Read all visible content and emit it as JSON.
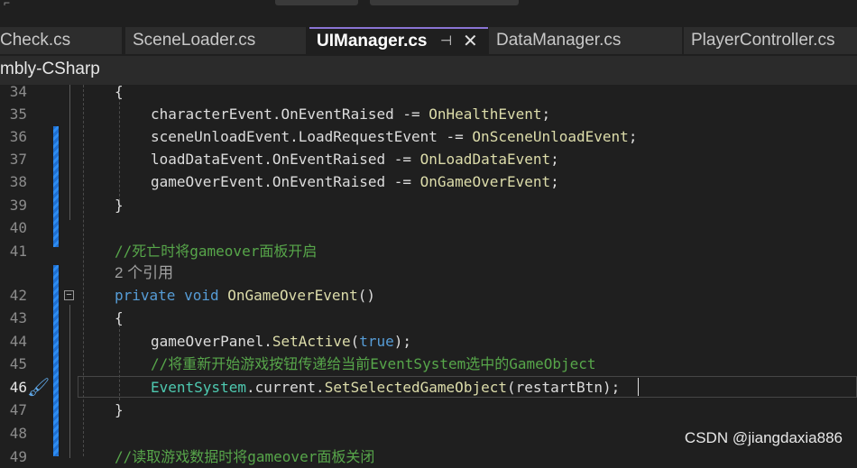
{
  "tabs": [
    {
      "label": "Check.cs",
      "active": false
    },
    {
      "label": "SceneLoader.cs",
      "active": false
    },
    {
      "label": "UIManager.cs",
      "active": true
    },
    {
      "label": "DataManager.cs",
      "active": false
    },
    {
      "label": "PlayerController.cs",
      "active": false
    }
  ],
  "active_tab": {
    "pin_icon": "⊣",
    "close_icon": "✕"
  },
  "project": {
    "label": "mbly-CSharp"
  },
  "editor": {
    "line_numbers": [
      "34",
      "35",
      "36",
      "37",
      "38",
      "39",
      "40",
      "41",
      "42",
      "43",
      "44",
      "45",
      "46",
      "47",
      "48",
      "49"
    ],
    "lines": {
      "l34": "{",
      "l35": [
        {
          "t": "characterEvent",
          "c": "var"
        },
        {
          "t": ".",
          "c": "plain"
        },
        {
          "t": "OnEventRaised",
          "c": "var"
        },
        {
          "t": " -= ",
          "c": "plain"
        },
        {
          "t": "OnHealthEvent",
          "c": "meth"
        },
        {
          "t": ";",
          "c": "plain"
        }
      ],
      "l36": [
        {
          "t": "sceneUnloadEvent",
          "c": "var"
        },
        {
          "t": ".",
          "c": "plain"
        },
        {
          "t": "LoadRequestEvent",
          "c": "var"
        },
        {
          "t": " -= ",
          "c": "plain"
        },
        {
          "t": "OnSceneUnloadEvent",
          "c": "meth"
        },
        {
          "t": ";",
          "c": "plain"
        }
      ],
      "l37": [
        {
          "t": "loadDataEvent",
          "c": "var"
        },
        {
          "t": ".",
          "c": "plain"
        },
        {
          "t": "OnEventRaised",
          "c": "var"
        },
        {
          "t": " -= ",
          "c": "plain"
        },
        {
          "t": "OnLoadDataEvent",
          "c": "meth"
        },
        {
          "t": ";",
          "c": "plain"
        }
      ],
      "l38": [
        {
          "t": "gameOverEvent",
          "c": "var"
        },
        {
          "t": ".",
          "c": "plain"
        },
        {
          "t": "OnEventRaised",
          "c": "var"
        },
        {
          "t": " -= ",
          "c": "plain"
        },
        {
          "t": "OnGameOverEvent",
          "c": "meth"
        },
        {
          "t": ";",
          "c": "plain"
        }
      ],
      "l39": "}",
      "l41": "//死亡时将gameover面板开启",
      "codelens": "2 个引用",
      "l42": [
        {
          "t": "private",
          "c": "kw"
        },
        {
          "t": " ",
          "c": "plain"
        },
        {
          "t": "void",
          "c": "kw"
        },
        {
          "t": " ",
          "c": "plain"
        },
        {
          "t": "OnGameOverEvent",
          "c": "meth"
        },
        {
          "t": "()",
          "c": "plain"
        }
      ],
      "l43": "{",
      "l44": [
        {
          "t": "gameOverPanel",
          "c": "var"
        },
        {
          "t": ".",
          "c": "plain"
        },
        {
          "t": "SetActive",
          "c": "meth"
        },
        {
          "t": "(",
          "c": "plain"
        },
        {
          "t": "true",
          "c": "kw"
        },
        {
          "t": ");",
          "c": "plain"
        }
      ],
      "l45": "//将重新开始游戏按钮传递给当前EventSystem选中的GameObject",
      "l46": [
        {
          "t": "EventSystem",
          "c": "cls"
        },
        {
          "t": ".",
          "c": "plain"
        },
        {
          "t": "current",
          "c": "var"
        },
        {
          "t": ".",
          "c": "plain"
        },
        {
          "t": "SetSelectedGameObject",
          "c": "meth"
        },
        {
          "t": "(restartBtn);",
          "c": "plain"
        }
      ],
      "l47": "}",
      "l49": "//读取游戏数据时将gameover面板关闭"
    }
  },
  "watermark": "CSDN @jiangdaxia886",
  "colors": {
    "keyword": "#569cd6",
    "method": "#dcdcaa",
    "class": "#4ec9b0",
    "comment": "#57a64a",
    "tab_accent": "#8a74d4",
    "change_bar": "#1f6fd1"
  }
}
